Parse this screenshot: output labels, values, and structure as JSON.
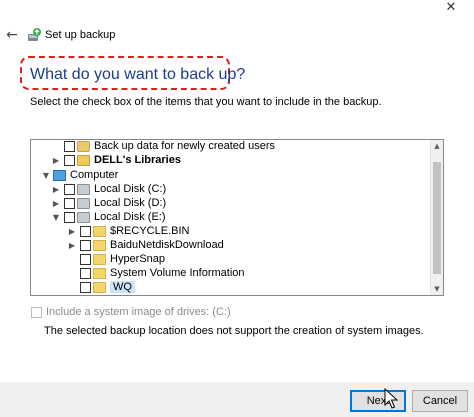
{
  "window": {
    "close_glyph": "✕",
    "back_glyph": "←",
    "title": "Set up backup",
    "app_icon": "backup-app-icon"
  },
  "main": {
    "heading": "What do you want to back up?",
    "instruction": "Select the check box of the items that you want to include in the backup."
  },
  "tree": {
    "items": [
      {
        "label": "Back up data for newly created users",
        "icon": "users-icon",
        "expander": "",
        "bold": false,
        "checked": false,
        "selected": false
      },
      {
        "label": "DELL's Libraries",
        "icon": "libraries-icon",
        "expander": "▶",
        "bold": true,
        "checked": false,
        "selected": false
      },
      {
        "label": "Computer",
        "icon": "computer-icon",
        "expander": "▼",
        "bold": false,
        "checked": null,
        "selected": false
      },
      {
        "label": "Local Disk (C:)",
        "icon": "disk-icon",
        "expander": "▶",
        "bold": false,
        "checked": false,
        "selected": false
      },
      {
        "label": "Local Disk (D:)",
        "icon": "disk-icon",
        "expander": "▶",
        "bold": false,
        "checked": false,
        "selected": false
      },
      {
        "label": "Local Disk (E:)",
        "icon": "disk-icon",
        "expander": "▼",
        "bold": false,
        "checked": false,
        "selected": false
      },
      {
        "label": "$RECYCLE.BIN",
        "icon": "folder-icon",
        "expander": "▶",
        "bold": false,
        "checked": false,
        "selected": false
      },
      {
        "label": "BaiduNetdiskDownload",
        "icon": "folder-icon",
        "expander": "▶",
        "bold": false,
        "checked": false,
        "selected": false
      },
      {
        "label": "HyperSnap",
        "icon": "folder-icon",
        "expander": "",
        "bold": false,
        "checked": false,
        "selected": false
      },
      {
        "label": "System Volume Information",
        "icon": "folder-icon",
        "expander": "",
        "bold": false,
        "checked": false,
        "selected": false
      },
      {
        "label": "WQ",
        "icon": "folder-icon",
        "expander": "",
        "bold": false,
        "checked": false,
        "selected": true
      }
    ]
  },
  "options": {
    "system_image_label": "Include a system image of drives: (C:)",
    "system_image_note": "The selected backup location does not support the creation of system images."
  },
  "footer": {
    "next_label": "Next",
    "cancel_label": "Cancel"
  },
  "colors": {
    "heading": "#1e3c8c",
    "highlight_outline": "#e0201a",
    "default_button_border": "#0078d7"
  }
}
